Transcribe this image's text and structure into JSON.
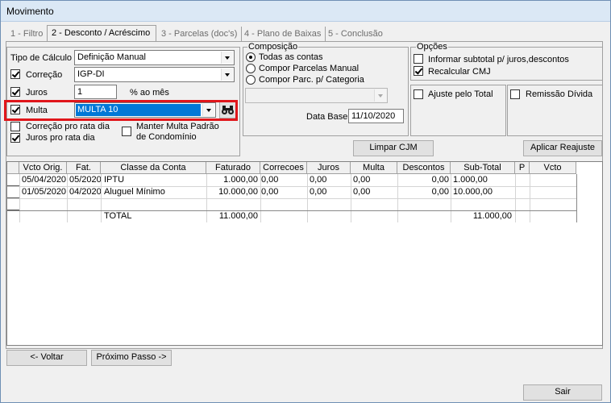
{
  "window": {
    "title": "Movimento"
  },
  "tabs": [
    {
      "label": "1 - Filtro"
    },
    {
      "label": "2 - Desconto / Acréscimo"
    },
    {
      "label": "3 - Parcelas (doc's)"
    },
    {
      "label": "4 - Plano de Baixas"
    },
    {
      "label": "5 - Conclusão"
    }
  ],
  "left": {
    "tipo_calculo_label": "Tipo de Cálculo",
    "tipo_calculo_value": "Definição Manual",
    "correcao_label": "Correção",
    "correcao_value": "IGP-DI",
    "juros_label": "Juros",
    "juros_value": "1",
    "juros_unit": "% ao mês",
    "multa_label": "Multa",
    "multa_value": "MULTA 10",
    "correcao_rata_label": "Correção pro rata dia",
    "juros_rata_label": "Juros pro rata dia",
    "manter_multa_line1": "Manter Multa Padrão",
    "manter_multa_line2": "de Condomínio"
  },
  "composicao": {
    "title": "Composição",
    "options": [
      "Todas as contas",
      "Compor Parcelas Manual",
      "Compor Parc. p/ Categoria"
    ],
    "categoria_value": "",
    "data_base_label": "Data Base",
    "data_base_value": "11/10/2020"
  },
  "opcoes": {
    "title": "Opções",
    "informar_subtotal": "Informar subtotal p/ juros,descontos",
    "recalcular_cmj": "Recalcular CMJ",
    "ajuste_total": "Ajuste pelo Total",
    "remissao_divida": "Remissão Dívida"
  },
  "buttons": {
    "limpar_cjm": "Limpar CJM",
    "aplicar_reajuste": "Aplicar Reajuste",
    "voltar": "<- Voltar",
    "proximo": "Próximo Passo ->",
    "sair": "Sair"
  },
  "grid": {
    "headers": [
      "Vcto Orig.",
      "Fat.",
      "Classe da Conta",
      "Faturado",
      "Correcoes",
      "Juros",
      "Multa",
      "Descontos",
      "Sub-Total",
      "P",
      "Vcto"
    ],
    "rows": [
      {
        "vcto": "05/04/2020",
        "fat": "05/2020",
        "classe": "IPTU",
        "faturado": "1.000,00",
        "correcoes": "0,00",
        "juros": "0,00",
        "multa": "0,00",
        "descontos": "0,00",
        "subtotal": "1.000,00"
      },
      {
        "vcto": "01/05/2020",
        "fat": "04/2020",
        "classe": "Aluguel Mínimo",
        "faturado": "10.000,00",
        "correcoes": "0,00",
        "juros": "0,00",
        "multa": "0,00",
        "descontos": "0,00",
        "subtotal": "10.000,00"
      }
    ],
    "total": {
      "label": "TOTAL",
      "faturado": "11.000,00",
      "subtotal": "11.000,00"
    }
  },
  "colors": {
    "highlight": "#e0161b",
    "selection": "#0078d7"
  }
}
